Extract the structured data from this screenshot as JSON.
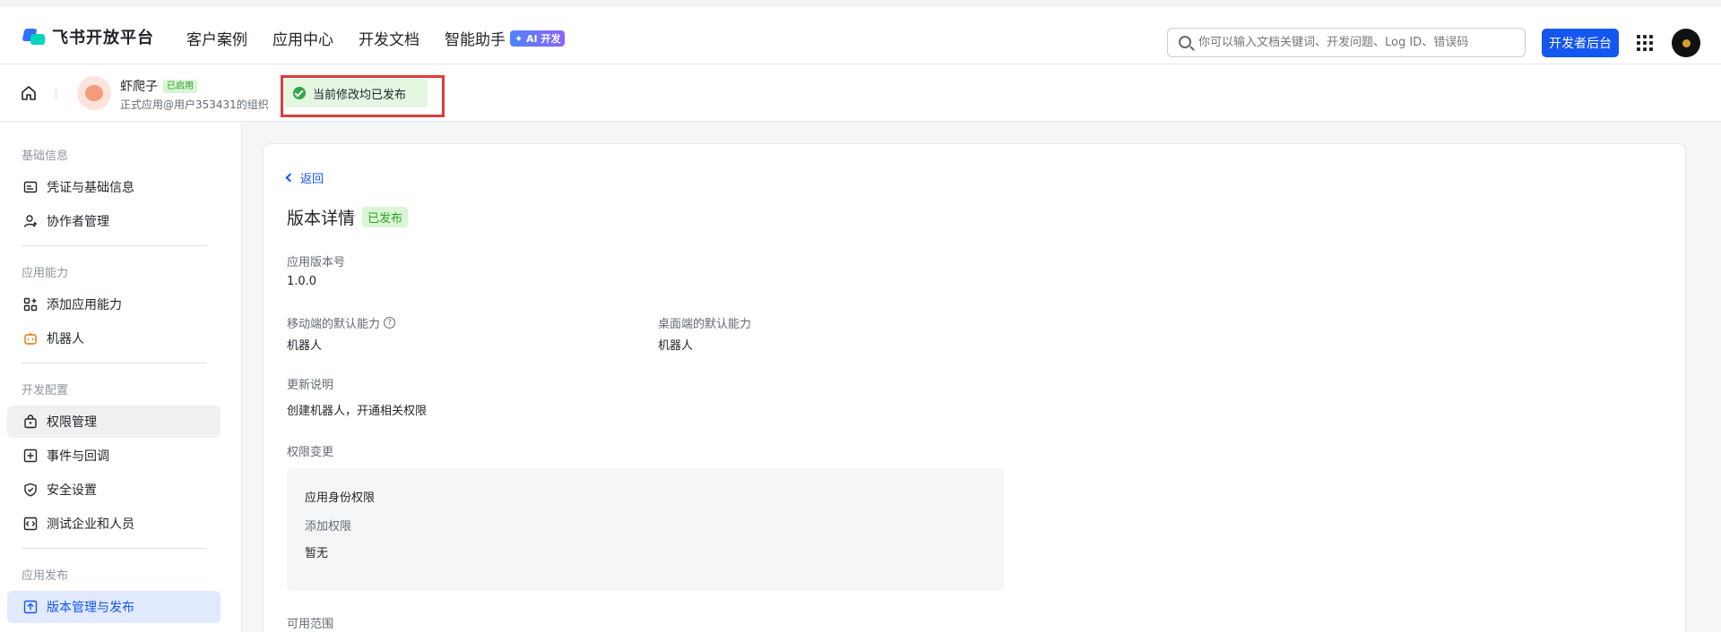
{
  "topbar": {
    "logo_text": "飞书开放平台",
    "nav": [
      "客户案例",
      "应用中心",
      "开发文档",
      "智能助手"
    ],
    "ai_badge": "✦ AI 开发",
    "search_placeholder": "你可以输入文档关键词、开发问题、Log ID、错误码",
    "dev_console_label": "开发者后台"
  },
  "appbar": {
    "app_name": "虾爬子",
    "enabled_tag": "已启用",
    "app_sub": "正式应用@用户353431的组织",
    "publish_status": "当前修改均已发布"
  },
  "sidebar": {
    "sections": [
      {
        "title": "基础信息",
        "items": [
          "凭证与基础信息",
          "协作者管理"
        ]
      },
      {
        "title": "应用能力",
        "items": [
          "添加应用能力",
          "机器人"
        ]
      },
      {
        "title": "开发配置",
        "items": [
          "权限管理",
          "事件与回调",
          "安全设置",
          "测试企业和人员"
        ]
      },
      {
        "title": "应用发布",
        "items": [
          "版本管理与发布"
        ]
      }
    ]
  },
  "main": {
    "back_label": "返回",
    "title": "版本详情",
    "status_tag": "已发布",
    "version_label": "应用版本号",
    "version_value": "1.0.0",
    "mobile_label": "移动端的默认能力",
    "mobile_value": "机器人",
    "desktop_label": "桌面端的默认能力",
    "desktop_value": "机器人",
    "notes_label": "更新说明",
    "notes_value": "创建机器人，开通相关权限",
    "perm_change_label": "权限变更",
    "perm_box": {
      "title": "应用身份权限",
      "sub": "添加权限",
      "value": "暂无"
    },
    "scope_label": "可用范围"
  }
}
